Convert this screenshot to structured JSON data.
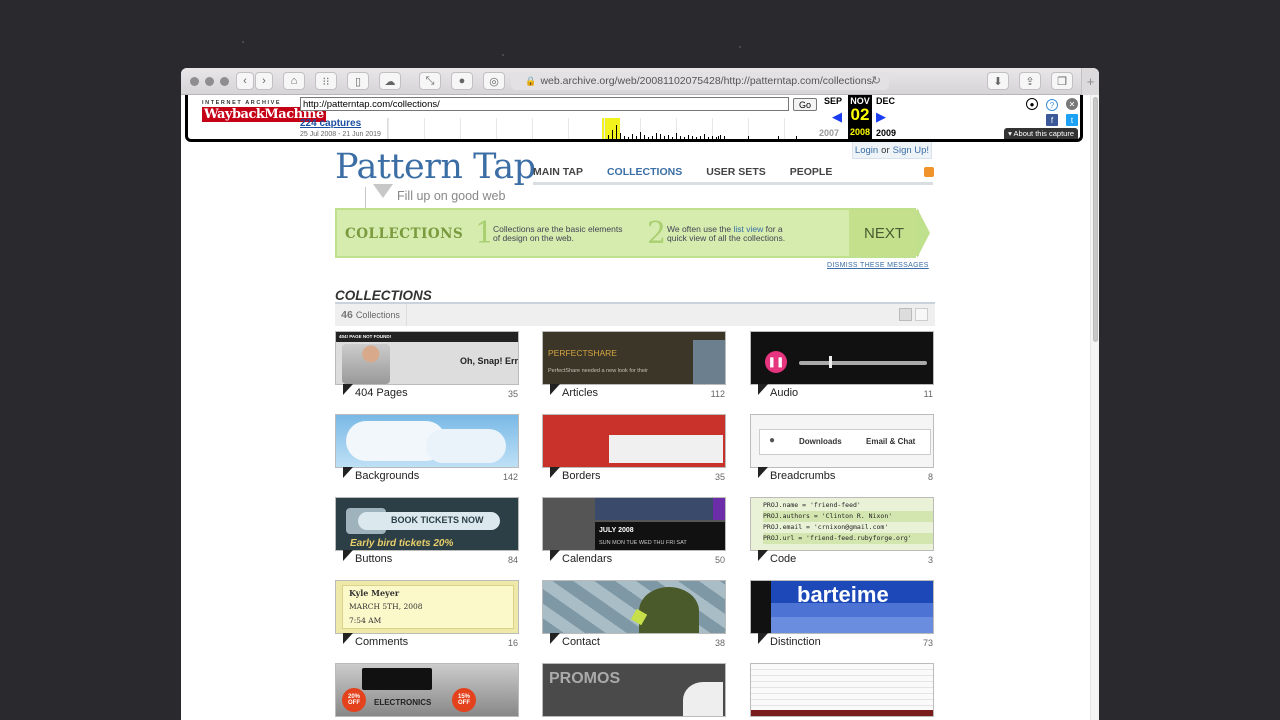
{
  "browser": {
    "url": "web.archive.org/web/20081102075428/http://patterntap.com/collections/",
    "plus_tab": "+"
  },
  "wayback": {
    "logo_top": "INTERNET ARCHIVE",
    "logo": "WaybackMachine",
    "url_value": "http://patterntap.com/collections/",
    "go": "Go",
    "captures": "224 captures",
    "range": "25 Jul 2008 - 21 Jun 2019",
    "month_prev": "SEP",
    "month_cur": "NOV",
    "month_next": "DEC",
    "day": "02",
    "year_prev": "2007",
    "year_cur": "2008",
    "year_next": "2009",
    "about": "▾ About this capture"
  },
  "site": {
    "login": "Login",
    "or": "or",
    "signup": "Sign Up!",
    "logo": "Pattern Tap",
    "tagline": "Fill up on good web",
    "nav": [
      "MAIN TAP",
      "COLLECTIONS",
      "USER SETS",
      "PEOPLE"
    ],
    "banner_title": "COLLECTIONS",
    "step1_num": "1",
    "step1_text": "Collections are the basic elements of design on the web.",
    "step2_num": "2",
    "step2_pre": "We often use the",
    "step2_link": "list view",
    "step2_post": "for a quick view of all the collections.",
    "next": "NEXT",
    "dismiss": "DISMISS THESE MESSAGES",
    "collections_title": "COLLECTIONS",
    "collections_count": "46",
    "collections_label": "Collections"
  },
  "thumb_text": {
    "p404_top": "404! PAGE NOT FOUND!",
    "p404_main": "Oh, Snap! Err",
    "articles_brand": "PERFECTSHARE",
    "articles_body": "PerfectShare needed a new look for their",
    "buttons": "BOOK TICKETS NOW",
    "buttons_sub": "Early bird tickets 20%",
    "bc_downloads": "Downloads",
    "bc_email": "Email & Chat",
    "cal_month": "JULY 2008",
    "cal_days": "SUN  MON  TUE  WED  THU  FRI  SAT",
    "code_lines": [
      "PROJ.name = 'friend-feed'",
      "PROJ.authors = 'Clinton R. Nixon'",
      "PROJ.email = 'crnixon@gmail.com'",
      "PROJ.url = 'friend-feed.rubyforge.org'"
    ],
    "comment_name": "Kyle Meyer",
    "comment_date": "MARCH 5TH, 2008",
    "comment_time": "7:54 AM",
    "distinction": "barteime",
    "electronics": "ELECTRONICS",
    "off20": "20% OFF",
    "off15": "15% OFF",
    "promos": "PROMOS"
  },
  "collections": [
    {
      "label": "404 Pages",
      "count": "35"
    },
    {
      "label": "Articles",
      "count": "112"
    },
    {
      "label": "Audio",
      "count": "11"
    },
    {
      "label": "Backgrounds",
      "count": "142"
    },
    {
      "label": "Borders",
      "count": "35"
    },
    {
      "label": "Breadcrumbs",
      "count": "8"
    },
    {
      "label": "Buttons",
      "count": "84"
    },
    {
      "label": "Calendars",
      "count": "50"
    },
    {
      "label": "Code",
      "count": "3"
    },
    {
      "label": "Comments",
      "count": "16"
    },
    {
      "label": "Contact",
      "count": "38"
    },
    {
      "label": "Distinction",
      "count": "73"
    }
  ],
  "colors": {
    "brand_blue": "#3c6ea6",
    "banner_green": "#d5ecae",
    "wayback_red": "#c50016"
  }
}
